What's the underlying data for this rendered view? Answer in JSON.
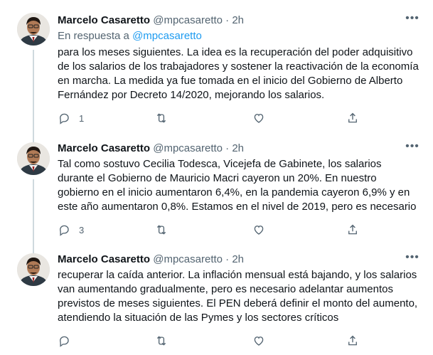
{
  "tweets": [
    {
      "author": {
        "name": "Marcelo Casaretto",
        "handle": "@mpcasaretto"
      },
      "separator": "·",
      "time": "2h",
      "more_label": "•••",
      "reply_to": {
        "prefix": "En respuesta a",
        "mention": "@mpcasaretto"
      },
      "text": "para los meses siguientes. La idea es la recuperación del poder adquisitivo de los salarios de los trabajadores y sostener la reactivación de la economía en marcha. La medida ya fue tomada en el inicio del Gobierno de Alberto Fernández por Decreto 14/2020, mejorando los salarios.",
      "actions": {
        "reply_count": "1",
        "retweet_count": "",
        "like_count": ""
      }
    },
    {
      "author": {
        "name": "Marcelo Casaretto",
        "handle": "@mpcasaretto"
      },
      "separator": "·",
      "time": "2h",
      "more_label": "•••",
      "text": "Tal como sostuvo Cecilia Todesca, Vicejefa de Gabinete, los salarios durante el Gobierno de Mauricio Macri cayeron un 20%. En nuestro gobierno en el inicio aumentaron 6,4%, en la pandemia cayeron 6,9% y en este año aumentaron 0,8%. Estamos en el nivel de 2019, pero es necesario",
      "actions": {
        "reply_count": "3",
        "retweet_count": "",
        "like_count": ""
      }
    },
    {
      "author": {
        "name": "Marcelo Casaretto",
        "handle": "@mpcasaretto"
      },
      "separator": "·",
      "time": "2h",
      "more_label": "•••",
      "text": "recuperar la caída anterior. La inflación mensual está bajando, y los salarios van aumentando gradualmente, pero es necesario adelantar aumentos previstos de meses siguientes. El PEN deberá definir el monto del aumento, atendiendo la situación de las Pymes y los sectores críticos",
      "actions": {
        "reply_count": "",
        "retweet_count": "",
        "like_count": ""
      }
    }
  ],
  "colors": {
    "text": "#0f1419",
    "secondary": "#536471",
    "link": "#1d9bf0",
    "thread_line": "#cfd9de",
    "divider": "#eff3f4"
  },
  "icons": [
    "more-icon",
    "reply-icon",
    "retweet-icon",
    "like-icon",
    "share-icon",
    "avatar"
  ]
}
